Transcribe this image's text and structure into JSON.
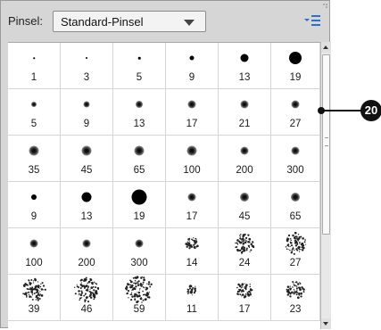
{
  "panel": {
    "label": "Pinsel:",
    "selected_set": "Standard-Pinsel",
    "menu_icon": "panel-menu-icon"
  },
  "brushes": [
    {
      "size": "1",
      "kind": "hard",
      "dot": 1.5
    },
    {
      "size": "3",
      "kind": "hard",
      "dot": 2
    },
    {
      "size": "5",
      "kind": "hard",
      "dot": 2.5
    },
    {
      "size": "9",
      "kind": "hard",
      "dot": 5
    },
    {
      "size": "13",
      "kind": "hard",
      "dot": 9
    },
    {
      "size": "19",
      "kind": "hard",
      "dot": 14
    },
    {
      "size": "5",
      "kind": "soft",
      "dot": 3
    },
    {
      "size": "9",
      "kind": "soft",
      "dot": 4
    },
    {
      "size": "13",
      "kind": "soft",
      "dot": 5
    },
    {
      "size": "17",
      "kind": "soft",
      "dot": 6
    },
    {
      "size": "21",
      "kind": "soft",
      "dot": 6
    },
    {
      "size": "27",
      "kind": "soft",
      "dot": 6
    },
    {
      "size": "35",
      "kind": "soft",
      "dot": 8
    },
    {
      "size": "45",
      "kind": "soft",
      "dot": 8
    },
    {
      "size": "65",
      "kind": "soft",
      "dot": 8
    },
    {
      "size": "100",
      "kind": "soft",
      "dot": 8
    },
    {
      "size": "200",
      "kind": "soft",
      "dot": 6
    },
    {
      "size": "300",
      "kind": "soft",
      "dot": 6
    },
    {
      "size": "9",
      "kind": "hard",
      "dot": 6
    },
    {
      "size": "13",
      "kind": "hard",
      "dot": 11
    },
    {
      "size": "19",
      "kind": "hard",
      "dot": 17
    },
    {
      "size": "17",
      "kind": "soft",
      "dot": 6
    },
    {
      "size": "45",
      "kind": "soft",
      "dot": 7
    },
    {
      "size": "65",
      "kind": "soft",
      "dot": 7
    },
    {
      "size": "100",
      "kind": "soft",
      "dot": 6
    },
    {
      "size": "200",
      "kind": "soft",
      "dot": 6
    },
    {
      "size": "300",
      "kind": "soft",
      "dot": 6
    },
    {
      "size": "14",
      "kind": "splat",
      "dot": 10
    },
    {
      "size": "24",
      "kind": "splat",
      "dot": 18
    },
    {
      "size": "27",
      "kind": "splat",
      "dot": 20
    },
    {
      "size": "39",
      "kind": "splat",
      "dot": 22
    },
    {
      "size": "46",
      "kind": "splat",
      "dot": 24
    },
    {
      "size": "59",
      "kind": "splat",
      "dot": 26
    },
    {
      "size": "11",
      "kind": "splat",
      "dot": 8
    },
    {
      "size": "17",
      "kind": "splat",
      "dot": 14
    },
    {
      "size": "23",
      "kind": "splat",
      "dot": 16
    }
  ],
  "callout": {
    "number": "20"
  },
  "colors": {
    "panel": "#d6d6d6",
    "grid": "#ffffff",
    "dot": "#000000",
    "callout": "#111111"
  }
}
